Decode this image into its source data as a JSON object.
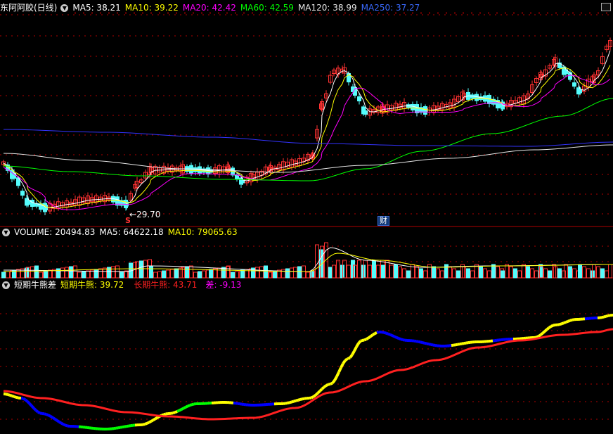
{
  "colors": {
    "ma5": "#ffffff",
    "ma10": "#ffff00",
    "ma20": "#ff00ff",
    "ma60": "#00ff00",
    "ma120": "#e8e8e8",
    "ma250": "#3333ff",
    "up": "#ff3232",
    "down": "#54fcfc",
    "grid": "#b00000",
    "short": "#ffff00",
    "long": "#ff2020",
    "diff": "#ff00ff"
  },
  "price_legend": {
    "title": "东阿阿胶(日线)",
    "ma5": "MA5: 38.21",
    "ma10": "MA10: 39.22",
    "ma20": "MA20: 42.42",
    "ma60": "MA60: 42.59",
    "ma120": "MA120: 38.99",
    "ma250": "MA250: 37.27"
  },
  "low_label": "29.70",
  "marker_s": "S",
  "marker_cai": "财",
  "volume_legend": {
    "volume": "VOLUME: 20494.83",
    "ma5": "MA5: 64622.18",
    "ma10": "MA10: 79065.63"
  },
  "indicator_legend": {
    "title": "短期牛熊差",
    "short": "短期牛熊: 39.72",
    "long": "长期牛熊: 43.71",
    "diff": "差: -9.13"
  },
  "chart_data": {
    "type": "candlestick",
    "title": "东阿阿胶(日线)",
    "low_marker": 29.7,
    "ma_latest": {
      "MA5": 38.21,
      "MA10": 39.22,
      "MA20": 42.42,
      "MA60": 42.59,
      "MA120": 38.99,
      "MA250": 37.27
    },
    "volume_latest": {
      "VOLUME": 20494.83,
      "MA5": 64622.18,
      "MA10": 79065.63
    },
    "indicator_latest": {
      "短期牛熊": 39.72,
      "长期牛熊": 43.71,
      "差": -9.13
    }
  }
}
